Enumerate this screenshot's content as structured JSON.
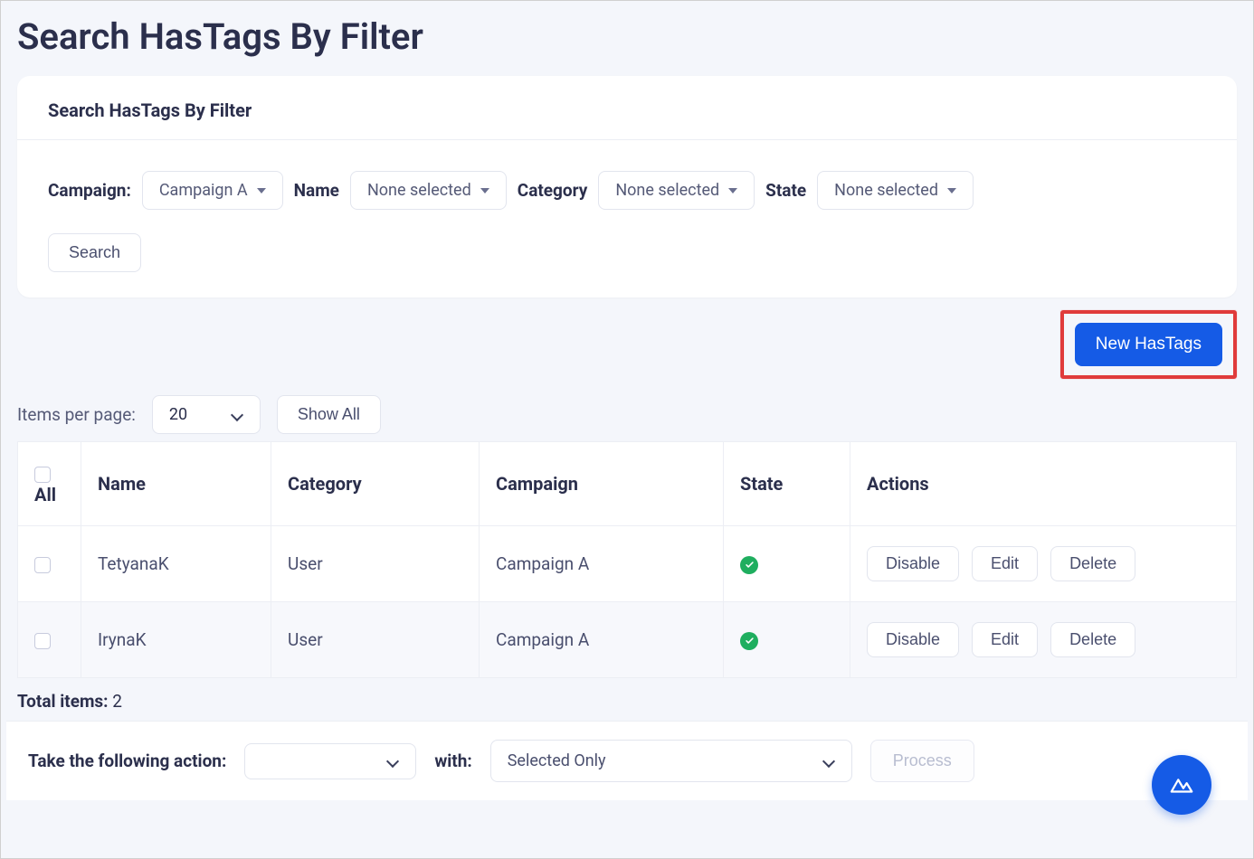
{
  "page": {
    "title": "Search HasTags By Filter"
  },
  "filter_card": {
    "heading": "Search HasTags By Filter",
    "fields": {
      "campaign": {
        "label": "Campaign:",
        "value": "Campaign A"
      },
      "name": {
        "label": "Name",
        "value": "None selected"
      },
      "category": {
        "label": "Category",
        "value": "None selected"
      },
      "state": {
        "label": "State",
        "value": "None selected"
      }
    },
    "search_button": "Search"
  },
  "new_button": "New HasTags",
  "list_controls": {
    "items_per_page_label": "Items per page:",
    "items_per_page_value": "20",
    "show_all": "Show All"
  },
  "table": {
    "columns": {
      "all": "All",
      "name": "Name",
      "category": "Category",
      "campaign": "Campaign",
      "state": "State",
      "actions": "Actions"
    },
    "rows": [
      {
        "name": "TetyanaK",
        "category": "User",
        "campaign": "Campaign A",
        "state": "active"
      },
      {
        "name": "IrynaK",
        "category": "User",
        "campaign": "Campaign A",
        "state": "active"
      }
    ],
    "row_actions": {
      "disable": "Disable",
      "edit": "Edit",
      "delete": "Delete"
    }
  },
  "totals": {
    "label": "Total items:",
    "value": "2"
  },
  "bulk": {
    "label": "Take the following action:",
    "with_label": "with:",
    "with_value": "Selected Only",
    "process": "Process"
  }
}
